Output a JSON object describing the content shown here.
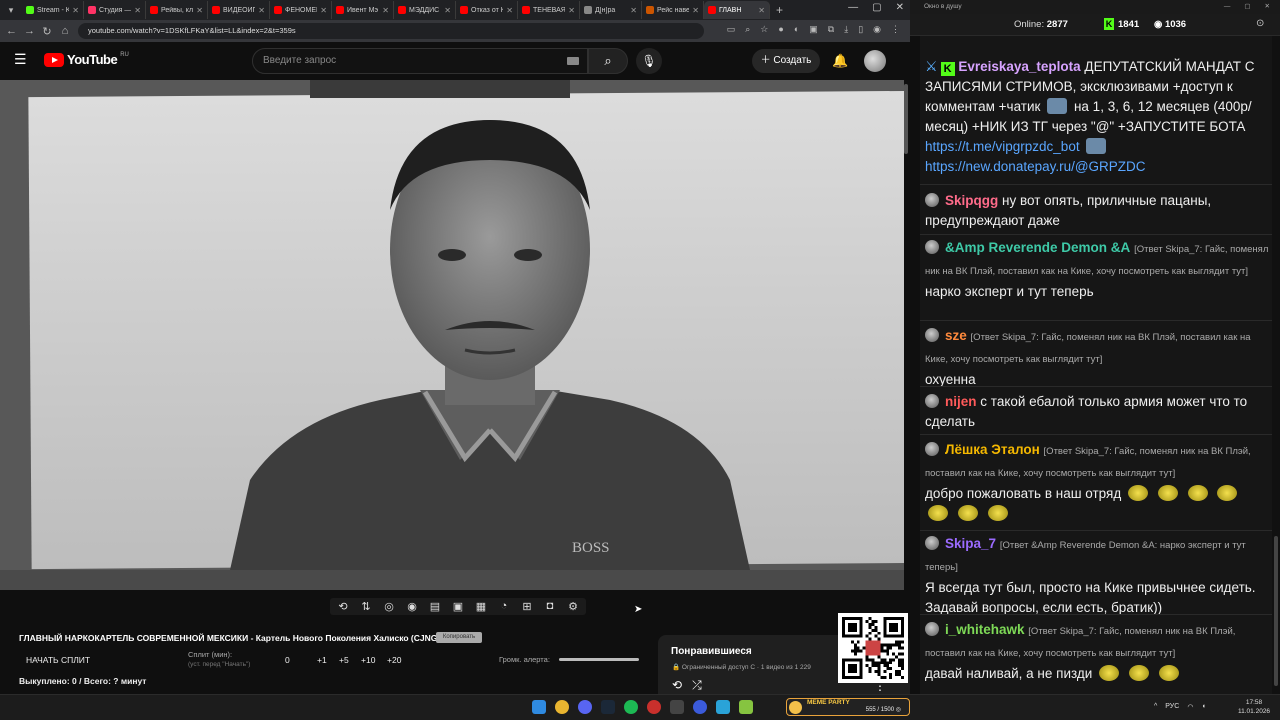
{
  "browser": {
    "tabs": [
      {
        "label": "Stream - K",
        "color": "#53fc18"
      },
      {
        "label": "Студия —",
        "color": "#ff3366"
      },
      {
        "label": "Рейвы, кл",
        "color": "#ff0000"
      },
      {
        "label": "ВИДЕОИГР",
        "color": "#ff0000"
      },
      {
        "label": "ФЕНОМЕН",
        "color": "#ff0000"
      },
      {
        "label": "Ивент Мэ",
        "color": "#ff0000"
      },
      {
        "label": "МЭДДИС",
        "color": "#ff0000"
      },
      {
        "label": "Отказ от К",
        "color": "#ff0000"
      },
      {
        "label": "ТЕНЕВАЯ",
        "color": "#ff0000"
      },
      {
        "label": "Д[н]ра",
        "color": "#888888"
      },
      {
        "label": "Рейс наве",
        "color": "#cc5500"
      },
      {
        "label": "ГЛАВН",
        "color": "#ff0000",
        "active": true
      }
    ],
    "url": "youtube.com/watch?v=1DSKfLFKaY&list=LL&index=2&t=359s"
  },
  "youtube": {
    "logo_text": "YouTube",
    "region": "RU",
    "search_placeholder": "Введите запрос",
    "create_label": "Создать",
    "logo_print": "BOSS"
  },
  "extension": {
    "video_title": "ГЛАВНЫЙ НАРКОКАРТЕЛЬ СОВРЕМЕННОЙ МЕКСИКИ - Картель Нового Поколения Халиско (CJNG)",
    "badge": "Копировать",
    "start_split": "НАЧАТЬ СПЛИТ",
    "split_label": "Сплит (мин):",
    "split_hint": "(уст. перед \"Начать\")",
    "split_value": "0",
    "split_steps": [
      "+1",
      "+5",
      "+10",
      "+20"
    ],
    "volume_label": "Громк. алерта:",
    "stats": "Выкуплено: 0 / Всего: ? минут"
  },
  "liked": {
    "title": "Понравившиеся",
    "subtitle": "🔒 Ограниченный доступ С · 1 видео из 1 229"
  },
  "chat": {
    "window_title": "Окно в душу",
    "online_label": "Online:",
    "online_count": "2877",
    "kick_count": "1841",
    "second_count": "1036",
    "messages": [
      {
        "nick": "Evreiskaya_teplota",
        "color": "#d7a3ff",
        "text_a": "ДЕПУТАТСКИЙ МАНДАТ С ЗАПИСЯМИ СТРИМОВ, эксклюзивами +доступ к комментам +чатик",
        "text_b": "на 1, 3, 6, 12 месяцев (400р/месяц) +НИК ИЗ ТГ через \"@\" +ЗАПУСТИТЕ БОТА",
        "link1": "https://t.me/vipgrpzdc_bot",
        "link2": "https://new.donatepay.ru/@GRPZDC"
      },
      {
        "nick": "Skipqgg",
        "color": "#ff6b8a",
        "text": "ну вот опять, приличные пацаны, предупреждают даже"
      },
      {
        "nick": "&Amp Reverende Demon &A",
        "color": "#3ec9a7",
        "reply": "[Ответ Skipa_7: Гайс, поменял ник на ВК Плэй, поставил как на Кике, хочу посмотреть как выглядит тут]",
        "text": "нарко эксперт и тут теперь"
      },
      {
        "nick": "sze",
        "color": "#ff8a3d",
        "reply": "[Ответ Skipa_7: Гайс, поменял ник на ВК Плэй, поставил как на Кике, хочу посмотреть как выглядит тут]",
        "text": "охуенна"
      },
      {
        "nick": "nijen",
        "color": "#ff5a5a",
        "text": "с такой ебалой только армия может что то сделать"
      },
      {
        "nick": "Лёшка Эталон",
        "color": "#f5b800",
        "reply": "[Ответ Skipa_7: Гайс, поменял ник на ВК Плэй, поставил как на Кике, хочу посмотреть как выглядит тут]",
        "text": "добро пожаловать в наш отряд"
      },
      {
        "nick": "Skipa_7",
        "color": "#9b6bff",
        "reply": "[Ответ &Amp Reverende Demon &A: нарко эксперт и тут теперь]",
        "text": "Я всегда тут был, просто на Кике привычнее сидеть. Задавай вопросы, если есть, братик))"
      },
      {
        "nick": "i_whitehawk",
        "color": "#7ed957",
        "reply": "[Ответ Skipa_7: Гайс, поменял ник на ВК Плэй, поставил как на Кике, хочу посмотреть как выглядит тут]",
        "text": "давай наливай, а не пизди"
      }
    ]
  },
  "taskbar": {
    "widget_title": "MEME PARTY",
    "widget_count": "555 / 1500 ◎",
    "lang": "РУС",
    "time": "17:58",
    "date": "11.01.2026"
  }
}
